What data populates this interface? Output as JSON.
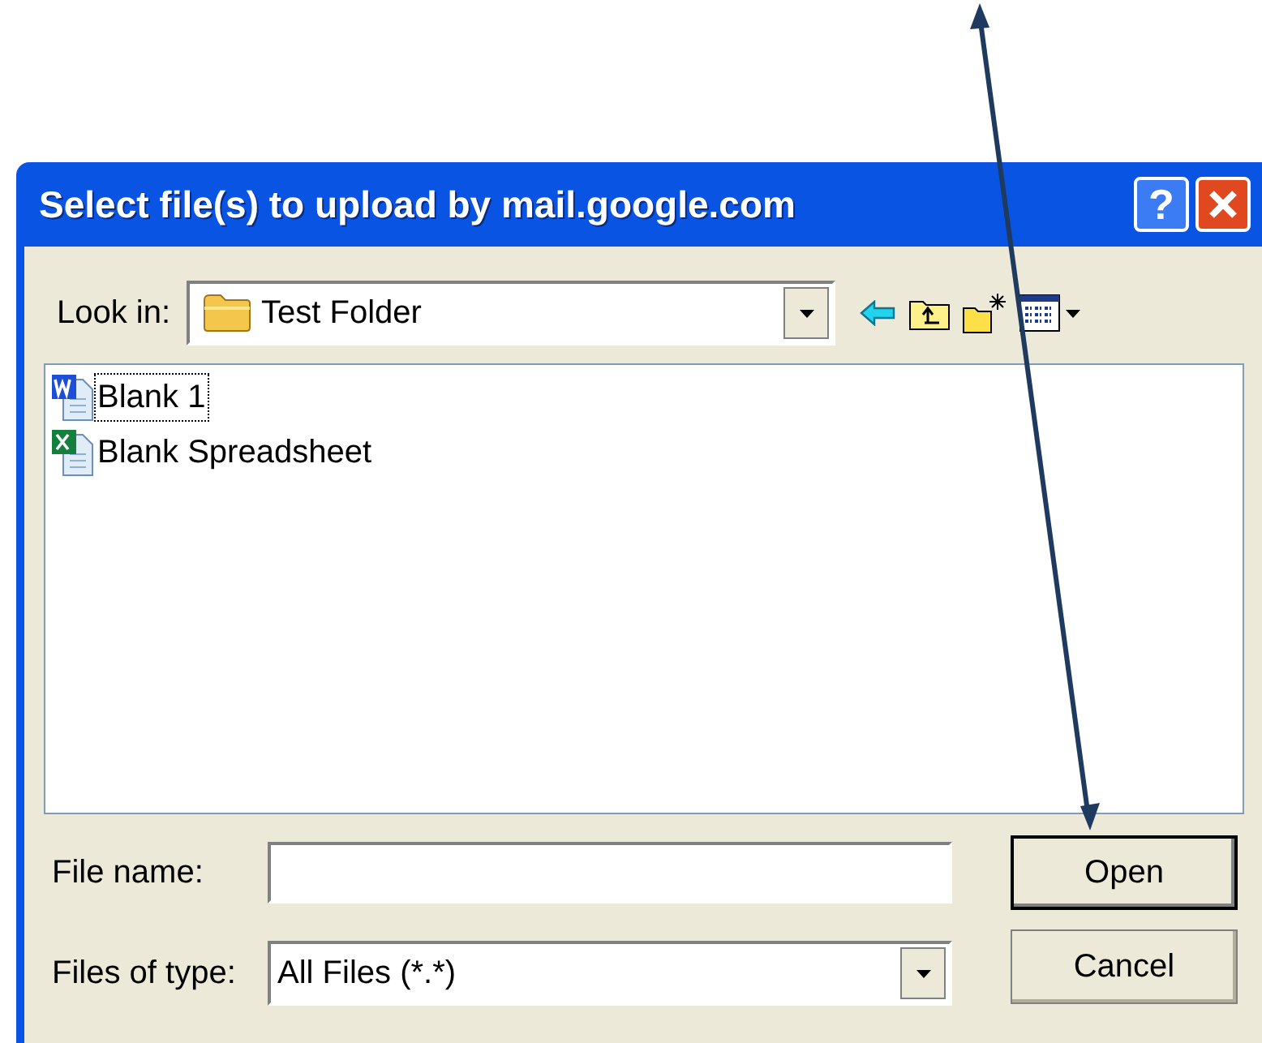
{
  "window": {
    "title": "Select file(s) to upload by mail.google.com",
    "buttons": [
      {
        "kind": "help",
        "label": "?"
      },
      {
        "kind": "close"
      }
    ]
  },
  "look_in": {
    "label": "Look in:",
    "value": "Test Folder"
  },
  "toolbar": [
    {
      "kind": "back"
    },
    {
      "kind": "up"
    },
    {
      "kind": "new-folder"
    },
    {
      "kind": "views"
    }
  ],
  "files": [
    {
      "name": "Blank 1",
      "kind": "word",
      "focused": true
    },
    {
      "name": "Blank Spreadsheet",
      "kind": "excel",
      "focused": false
    }
  ],
  "file_name": {
    "label": "File name:"
  },
  "file_type": {
    "label": "Files of type:",
    "value": "All Files (*.*)"
  },
  "buttons": [
    {
      "label": "Open",
      "default": true
    },
    {
      "label": "Cancel",
      "default": false
    }
  ]
}
